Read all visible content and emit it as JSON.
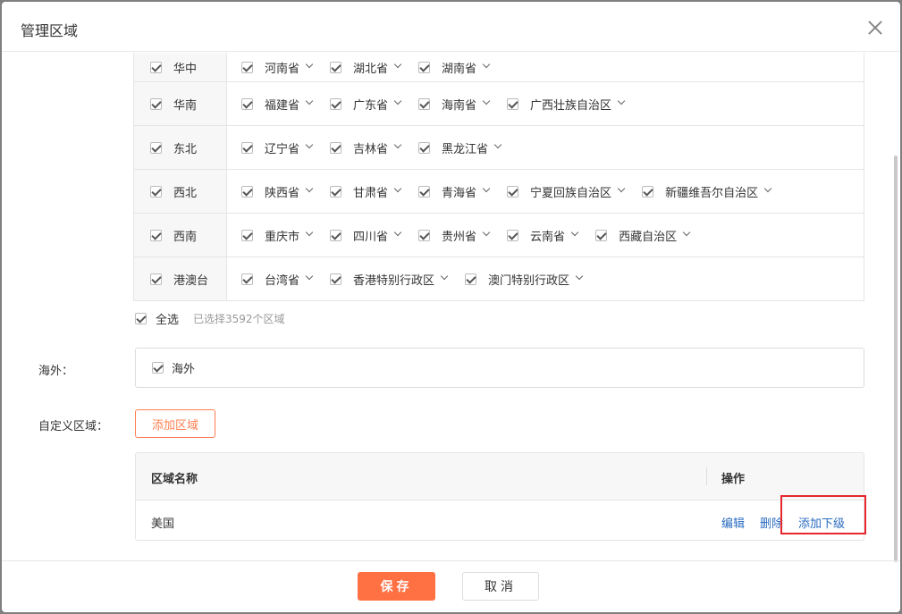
{
  "dialog": {
    "title": "管理区域"
  },
  "regions": [
    {
      "name": "华中",
      "provinces": [
        "河南省",
        "湖北省",
        "湖南省"
      ]
    },
    {
      "name": "华南",
      "provinces": [
        "福建省",
        "广东省",
        "海南省",
        "广西壮族自治区"
      ]
    },
    {
      "name": "东北",
      "provinces": [
        "辽宁省",
        "吉林省",
        "黑龙江省"
      ]
    },
    {
      "name": "西北",
      "provinces": [
        "陕西省",
        "甘肃省",
        "青海省",
        "宁夏回族自治区",
        "新疆维吾尔自治区"
      ]
    },
    {
      "name": "西南",
      "provinces": [
        "重庆市",
        "四川省",
        "贵州省",
        "云南省",
        "西藏自治区"
      ]
    },
    {
      "name": "港澳台",
      "provinces": [
        "台湾省",
        "香港特别行政区",
        "澳门特别行政区"
      ]
    }
  ],
  "select_all": {
    "label": "全选",
    "count_text": "已选择3592个区域"
  },
  "overseas": {
    "row_label": "海外：",
    "option": "海外"
  },
  "custom": {
    "row_label": "自定义区域：",
    "add_button": "添加区域",
    "col_name": "区域名称",
    "col_action": "操作",
    "rows": [
      {
        "name": "美国"
      }
    ],
    "actions": {
      "edit": "编辑",
      "delete": "删除",
      "add_sub": "添加下级"
    }
  },
  "footer": {
    "save": "保存",
    "cancel": "取消"
  }
}
